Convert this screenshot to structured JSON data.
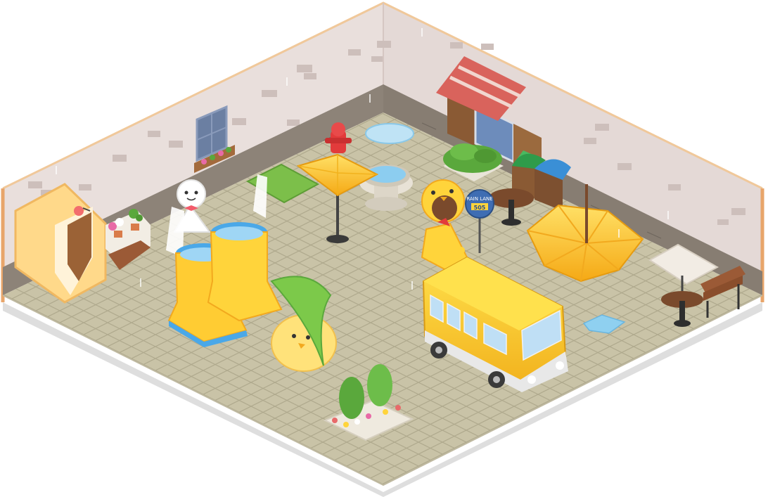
{
  "scene": {
    "title": "",
    "theme": "rainy-day-yellow-chick-room"
  },
  "colors": {
    "wall": "#e9dfdc",
    "wall_trim": "#e8b27a",
    "brick": "#cbbcb8",
    "stone_base": "#8c8277",
    "floor": "#c9c3a7",
    "floor_line": "#aaa488",
    "yellow": "#ffd43b",
    "yellow_dark": "#f2a91e",
    "boot_blue": "#4aa8e8",
    "awning_red": "#d9635c",
    "green": "#5aa83c",
    "wood": "#8a5a34"
  },
  "bus_stop_sign": {
    "line1": "RAIN LANE",
    "line2": "505"
  },
  "objects": [
    {
      "name": "chick-tent-hut",
      "interactable": true
    },
    {
      "name": "teru-teru-bozu-doll",
      "interactable": true
    },
    {
      "name": "flower-planter-shelf",
      "interactable": true
    },
    {
      "name": "giant-rain-boots",
      "interactable": true
    },
    {
      "name": "leaf-umbrella-chick",
      "interactable": true
    },
    {
      "name": "fire-hydrant",
      "interactable": true
    },
    {
      "name": "yellow-patio-umbrella",
      "interactable": true
    },
    {
      "name": "water-fountain",
      "interactable": true
    },
    {
      "name": "grass-patch",
      "interactable": false
    },
    {
      "name": "chick-raincoat-avatar",
      "interactable": true
    },
    {
      "name": "bus-stop-sign",
      "interactable": true
    },
    {
      "name": "yellow-school-bus",
      "interactable": true
    },
    {
      "name": "open-umbrella-on-ground",
      "interactable": true
    },
    {
      "name": "shop-window-with-awning",
      "interactable": true
    },
    {
      "name": "recycling-bins",
      "interactable": true
    },
    {
      "name": "cafe-table-left",
      "interactable": true
    },
    {
      "name": "cafe-table-right",
      "interactable": true
    },
    {
      "name": "white-patio-umbrella",
      "interactable": true
    },
    {
      "name": "wooden-bench",
      "interactable": true
    },
    {
      "name": "shrub-flower-planter",
      "interactable": true
    },
    {
      "name": "puddle",
      "interactable": false
    }
  ]
}
